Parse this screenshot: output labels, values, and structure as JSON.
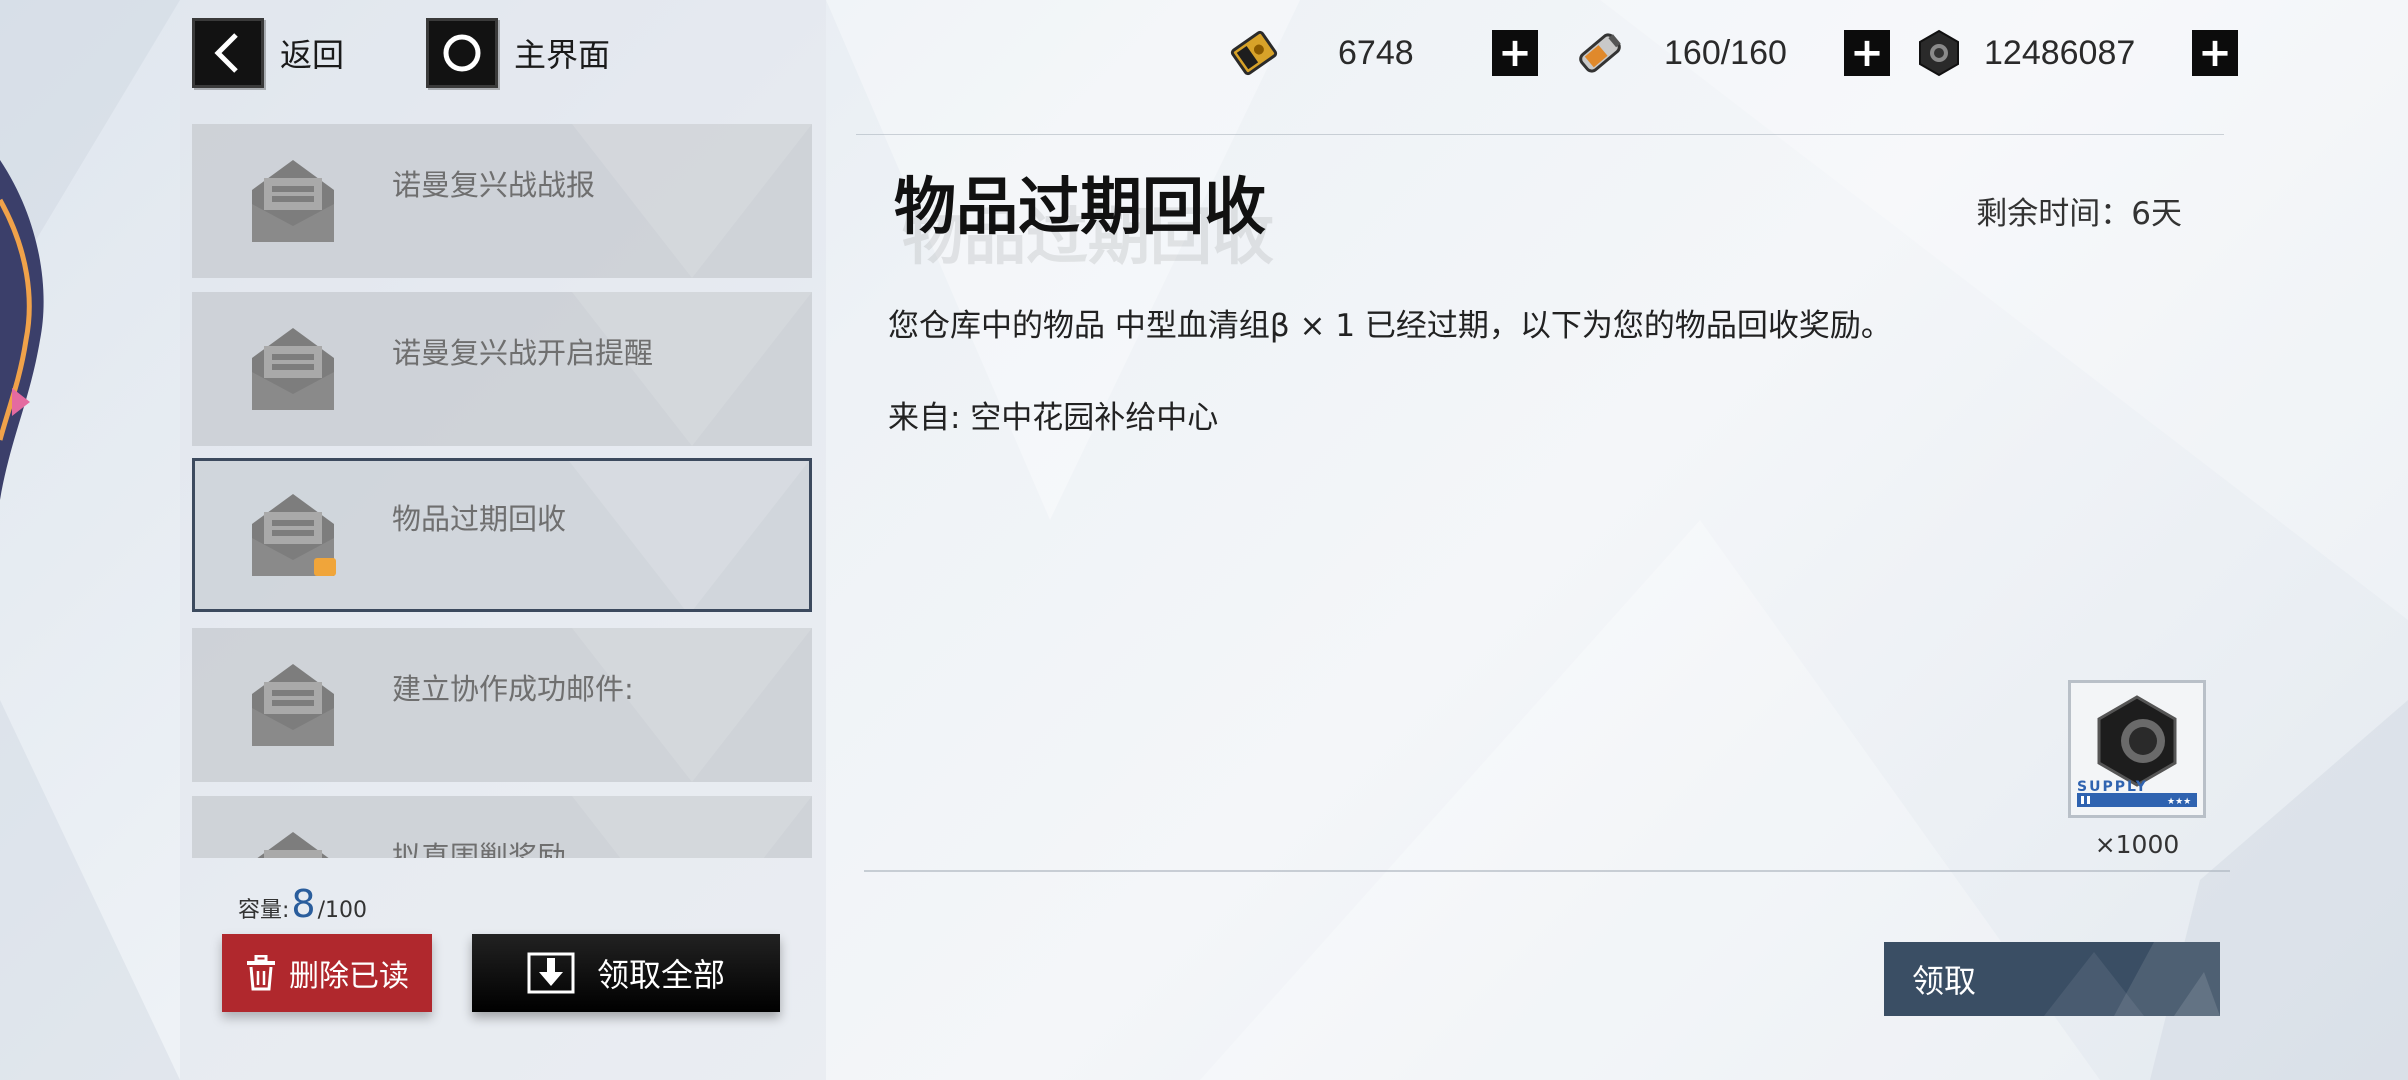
{
  "nav": {
    "back_label": "返回",
    "home_label": "主界面"
  },
  "resources": [
    {
      "icon": "gold-ticket-icon",
      "value": "6748"
    },
    {
      "icon": "energy-cell-icon",
      "value": "160/160"
    },
    {
      "icon": "hex-nut-icon",
      "value": "12486087"
    }
  ],
  "mail_list": [
    {
      "title": "诺曼复兴战战报",
      "selected": false,
      "has_attachment": false
    },
    {
      "title": "诺曼复兴战开启提醒",
      "selected": false,
      "has_attachment": false
    },
    {
      "title": "物品过期回收",
      "selected": true,
      "has_attachment": true
    },
    {
      "title": "建立协作成功邮件:",
      "selected": false,
      "has_attachment": false
    },
    {
      "title": "拟真围剿奖励",
      "selected": false,
      "has_attachment": false
    }
  ],
  "capacity": {
    "label": "容量:",
    "current": "8",
    "max": "/100"
  },
  "buttons": {
    "delete_read": "删除已读",
    "claim_all": "领取全部",
    "claim": "领取"
  },
  "detail": {
    "title": "物品过期回收",
    "remaining_time": "剩余时间：6天",
    "body": "您仓库中的物品 中型血清组β  × 1 已经过期，以下为您的物品回收奖励。",
    "from": "来自: 空中花园补给中心",
    "reward": {
      "icon": "hex-nut-icon",
      "badge": "SUPPLY",
      "quantity": "×1000"
    }
  },
  "colors": {
    "delete_button": "#b0282d",
    "claim_button": "#3a4e64",
    "capacity_number": "#2a5d9c",
    "selected_border": "#3c4a5e"
  }
}
